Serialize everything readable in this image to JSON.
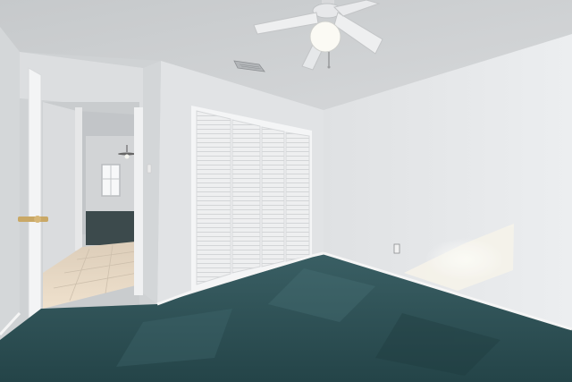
{
  "scene": {
    "description_id": "empty-bedroom-photo",
    "colors": {
      "ceiling": "#cdd0d2",
      "wall_right": "#e6e8ea",
      "wall_left": "#dfe1e3",
      "closet_door": "#ecedee",
      "carpet": "#2f5358",
      "carpet_dark": "#223f43",
      "tile": "#e8d9c6",
      "trim": "#f2f2f2",
      "sunlight": "#f4f2ea"
    },
    "elements": [
      "textured-ceiling",
      "ceiling-fan",
      "air-vent",
      "bifold-closet-door",
      "open-interior-door",
      "hallway",
      "window",
      "teal-carpet",
      "tile-floor",
      "electrical-outlet",
      "sunlight-patch"
    ]
  }
}
